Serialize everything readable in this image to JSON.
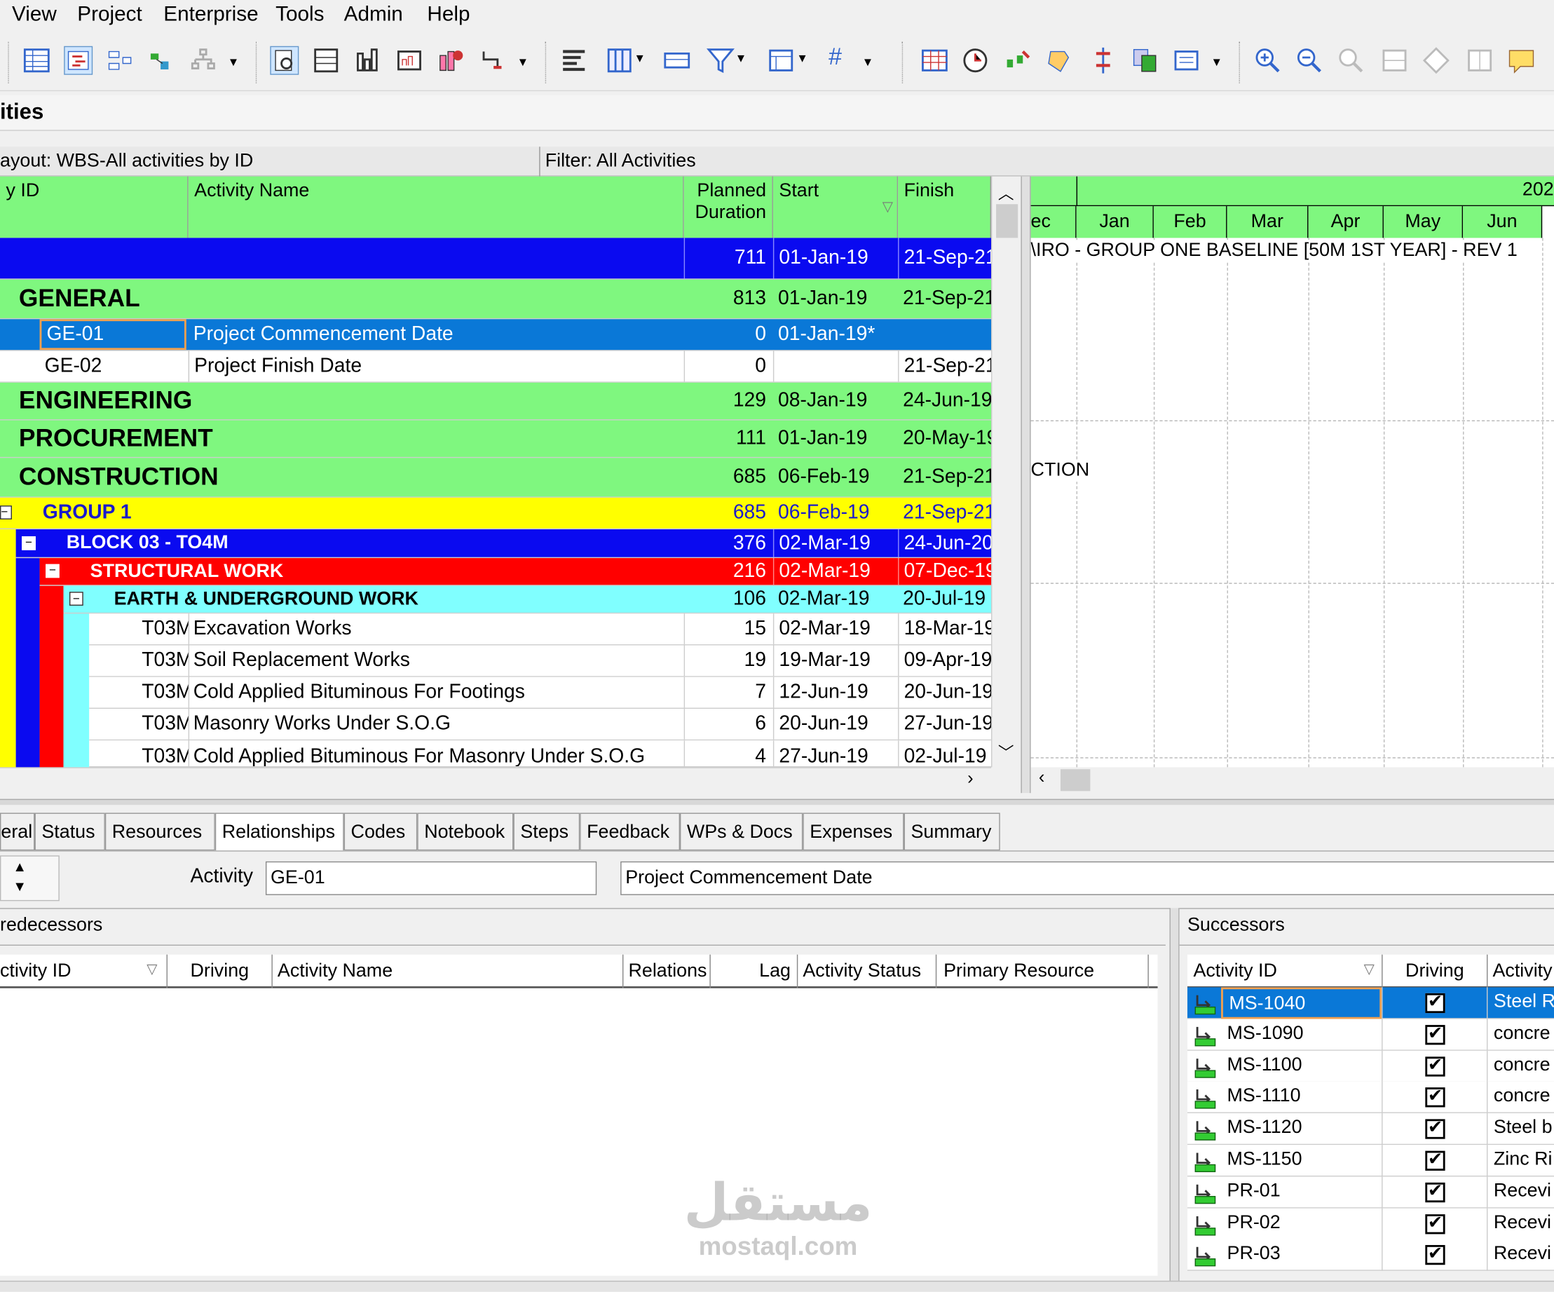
{
  "menu": [
    "View",
    "Project",
    "Enterprise",
    "Tools",
    "Admin",
    "Help"
  ],
  "title": "ities",
  "layout_label": "ayout: WBS-All activities by ID",
  "filter_label": "Filter: All Activities",
  "columns": {
    "id": "y ID",
    "name": "Activity Name",
    "duration_l1": "Planned",
    "duration_l2": "Duration",
    "start": "Start",
    "finish": "Finish"
  },
  "gantt": {
    "year": "202",
    "months": [
      "ec",
      "Jan",
      "Feb",
      "Mar",
      "Apr",
      "May",
      "Jun"
    ],
    "project_label": "\\IRO - GROUP ONE BASELINE [50M 1ST YEAR] - REV 1",
    "construction_label": "CTION"
  },
  "rows": [
    {
      "id": "",
      "name": "",
      "dur": "711",
      "start": "01-Jan-19",
      "finish": "21-Sep-21"
    },
    {
      "id": "GENERAL",
      "name": "",
      "dur": "813",
      "start": "01-Jan-19",
      "finish": "21-Sep-21"
    },
    {
      "id": "GE-01",
      "name": "Project Commencement Date",
      "dur": "0",
      "start": "01-Jan-19*",
      "finish": ""
    },
    {
      "id": "GE-02",
      "name": "Project Finish Date",
      "dur": "0",
      "start": "",
      "finish": "21-Sep-21"
    },
    {
      "id": "ENGINEERING",
      "name": "",
      "dur": "129",
      "start": "08-Jan-19",
      "finish": "24-Jun-19"
    },
    {
      "id": "PROCUREMENT",
      "name": "",
      "dur": "111",
      "start": "01-Jan-19",
      "finish": "20-May-19"
    },
    {
      "id": "CONSTRUCTION",
      "name": "",
      "dur": "685",
      "start": "06-Feb-19",
      "finish": "21-Sep-21"
    },
    {
      "id": "GROUP 1",
      "name": "",
      "dur": "685",
      "start": "06-Feb-19",
      "finish": "21-Sep-21"
    },
    {
      "id": "BLOCK 03 - TO4M",
      "name": "",
      "dur": "376",
      "start": "02-Mar-19",
      "finish": "24-Jun-20"
    },
    {
      "id": "STRUCTURAL WORK",
      "name": "",
      "dur": "216",
      "start": "02-Mar-19",
      "finish": "07-Dec-19"
    },
    {
      "id": "EARTH & UNDERGROUND WORK",
      "name": "",
      "dur": "106",
      "start": "02-Mar-19",
      "finish": "20-Jul-19"
    },
    {
      "id": "T03M",
      "name": "Excavation Works",
      "dur": "15",
      "start": "02-Mar-19",
      "finish": "18-Mar-19"
    },
    {
      "id": "T03M",
      "name": "Soil Replacement Works",
      "dur": "19",
      "start": "19-Mar-19",
      "finish": "09-Apr-19"
    },
    {
      "id": "T03M",
      "name": "Cold Applied Bituminous For Footings",
      "dur": "7",
      "start": "12-Jun-19",
      "finish": "20-Jun-19"
    },
    {
      "id": "T03M",
      "name": "Masonry Works Under S.O.G",
      "dur": "6",
      "start": "20-Jun-19",
      "finish": "27-Jun-19"
    },
    {
      "id": "T03M",
      "name": "Cold Applied Bituminous For Masonry Under S.O.G",
      "dur": "4",
      "start": "27-Jun-19",
      "finish": "02-Jul-19"
    }
  ],
  "tabs": [
    "eral",
    "Status",
    "Resources",
    "Relationships",
    "Codes",
    "Notebook",
    "Steps",
    "Feedback",
    "WPs & Docs",
    "Expenses",
    "Summary"
  ],
  "detail": {
    "activity_label": "Activity",
    "activity_id": "GE-01",
    "activity_name": "Project Commencement Date"
  },
  "predecessors": {
    "title": "redecessors",
    "headers": [
      "ctivity ID",
      "Driving",
      "Activity Name",
      "Relations",
      "Lag",
      "Activity Status",
      "Primary Resource"
    ]
  },
  "successors": {
    "title": "Successors",
    "headers": [
      "Activity ID",
      "Driving",
      "Activity"
    ],
    "rows": [
      {
        "id": "MS-1040",
        "name": "Steel R"
      },
      {
        "id": "MS-1090",
        "name": "concre"
      },
      {
        "id": "MS-1100",
        "name": "concre"
      },
      {
        "id": "MS-1110",
        "name": "concre"
      },
      {
        "id": "MS-1120",
        "name": "Steel b"
      },
      {
        "id": "MS-1150",
        "name": "Zinc Ri"
      },
      {
        "id": "PR-01",
        "name": "Recevi"
      },
      {
        "id": "PR-02",
        "name": "Recevi"
      },
      {
        "id": "PR-03",
        "name": "Recevi"
      }
    ]
  },
  "watermark": {
    "arabic": "مستقل",
    "latin": "mostaql.com"
  }
}
